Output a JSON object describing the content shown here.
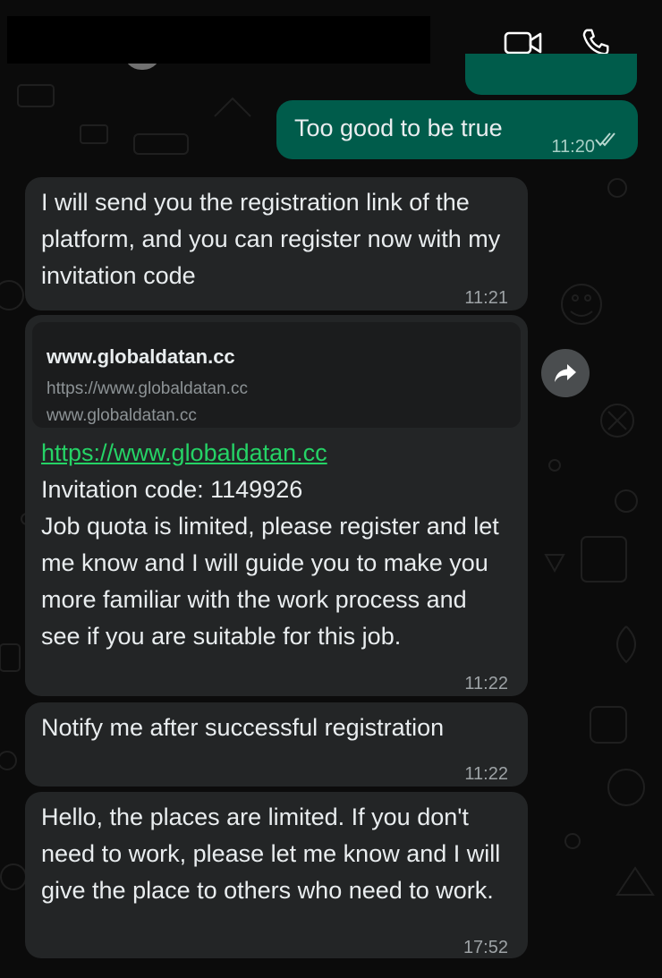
{
  "header": {
    "video_call_icon": "video-camera-icon",
    "voice_call_icon": "phone-icon"
  },
  "colors": {
    "background": "#0b0b0b",
    "incoming_bubble": "#232526",
    "outgoing_bubble": "#005c4b",
    "link": "#25d366",
    "timestamp": "#9ea3a6"
  },
  "messages": [
    {
      "direction": "outgoing",
      "text": "Too good to be true",
      "time": "11:20",
      "status_icon": "double-check-icon"
    },
    {
      "direction": "incoming",
      "text": "I will send you the registration link of the platform, and you can register now with my invitation code",
      "time": "11:21"
    },
    {
      "direction": "incoming",
      "link_preview": {
        "title": "www.globaldatan.cc",
        "url": "https://www.globaldatan.cc",
        "host": "www.globaldatan.cc"
      },
      "link": "https://www.globaldatan.cc",
      "text": "Invitation code: 1149926\nJob quota is limited, please register and let me know and I will guide you to make you more familiar with the work process and see if you are suitable for this job.",
      "time": "11:22",
      "action_icon": "forward-icon"
    },
    {
      "direction": "incoming",
      "text": "Notify me after successful registration",
      "time": "11:22"
    },
    {
      "direction": "incoming",
      "text": "Hello, the places are limited. If you don't need to work, please let me know and I will give the place to others who need to work.",
      "time": "17:52"
    }
  ]
}
